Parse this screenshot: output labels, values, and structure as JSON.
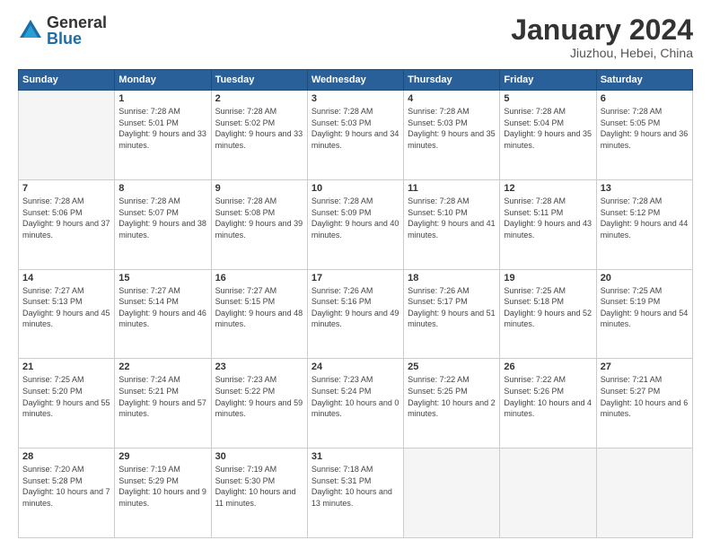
{
  "header": {
    "logo_general": "General",
    "logo_blue": "Blue",
    "month_title": "January 2024",
    "location": "Jiuzhou, Hebei, China"
  },
  "weekdays": [
    "Sunday",
    "Monday",
    "Tuesday",
    "Wednesday",
    "Thursday",
    "Friday",
    "Saturday"
  ],
  "weeks": [
    [
      {
        "day": "",
        "empty": true
      },
      {
        "day": "1",
        "sunrise": "7:28 AM",
        "sunset": "5:01 PM",
        "daylight": "9 hours and 33 minutes."
      },
      {
        "day": "2",
        "sunrise": "7:28 AM",
        "sunset": "5:02 PM",
        "daylight": "9 hours and 33 minutes."
      },
      {
        "day": "3",
        "sunrise": "7:28 AM",
        "sunset": "5:03 PM",
        "daylight": "9 hours and 34 minutes."
      },
      {
        "day": "4",
        "sunrise": "7:28 AM",
        "sunset": "5:03 PM",
        "daylight": "9 hours and 35 minutes."
      },
      {
        "day": "5",
        "sunrise": "7:28 AM",
        "sunset": "5:04 PM",
        "daylight": "9 hours and 35 minutes."
      },
      {
        "day": "6",
        "sunrise": "7:28 AM",
        "sunset": "5:05 PM",
        "daylight": "9 hours and 36 minutes."
      }
    ],
    [
      {
        "day": "7",
        "sunrise": "7:28 AM",
        "sunset": "5:06 PM",
        "daylight": "9 hours and 37 minutes."
      },
      {
        "day": "8",
        "sunrise": "7:28 AM",
        "sunset": "5:07 PM",
        "daylight": "9 hours and 38 minutes."
      },
      {
        "day": "9",
        "sunrise": "7:28 AM",
        "sunset": "5:08 PM",
        "daylight": "9 hours and 39 minutes."
      },
      {
        "day": "10",
        "sunrise": "7:28 AM",
        "sunset": "5:09 PM",
        "daylight": "9 hours and 40 minutes."
      },
      {
        "day": "11",
        "sunrise": "7:28 AM",
        "sunset": "5:10 PM",
        "daylight": "9 hours and 41 minutes."
      },
      {
        "day": "12",
        "sunrise": "7:28 AM",
        "sunset": "5:11 PM",
        "daylight": "9 hours and 43 minutes."
      },
      {
        "day": "13",
        "sunrise": "7:28 AM",
        "sunset": "5:12 PM",
        "daylight": "9 hours and 44 minutes."
      }
    ],
    [
      {
        "day": "14",
        "sunrise": "7:27 AM",
        "sunset": "5:13 PM",
        "daylight": "9 hours and 45 minutes."
      },
      {
        "day": "15",
        "sunrise": "7:27 AM",
        "sunset": "5:14 PM",
        "daylight": "9 hours and 46 minutes."
      },
      {
        "day": "16",
        "sunrise": "7:27 AM",
        "sunset": "5:15 PM",
        "daylight": "9 hours and 48 minutes."
      },
      {
        "day": "17",
        "sunrise": "7:26 AM",
        "sunset": "5:16 PM",
        "daylight": "9 hours and 49 minutes."
      },
      {
        "day": "18",
        "sunrise": "7:26 AM",
        "sunset": "5:17 PM",
        "daylight": "9 hours and 51 minutes."
      },
      {
        "day": "19",
        "sunrise": "7:25 AM",
        "sunset": "5:18 PM",
        "daylight": "9 hours and 52 minutes."
      },
      {
        "day": "20",
        "sunrise": "7:25 AM",
        "sunset": "5:19 PM",
        "daylight": "9 hours and 54 minutes."
      }
    ],
    [
      {
        "day": "21",
        "sunrise": "7:25 AM",
        "sunset": "5:20 PM",
        "daylight": "9 hours and 55 minutes."
      },
      {
        "day": "22",
        "sunrise": "7:24 AM",
        "sunset": "5:21 PM",
        "daylight": "9 hours and 57 minutes."
      },
      {
        "day": "23",
        "sunrise": "7:23 AM",
        "sunset": "5:22 PM",
        "daylight": "9 hours and 59 minutes."
      },
      {
        "day": "24",
        "sunrise": "7:23 AM",
        "sunset": "5:24 PM",
        "daylight": "10 hours and 0 minutes."
      },
      {
        "day": "25",
        "sunrise": "7:22 AM",
        "sunset": "5:25 PM",
        "daylight": "10 hours and 2 minutes."
      },
      {
        "day": "26",
        "sunrise": "7:22 AM",
        "sunset": "5:26 PM",
        "daylight": "10 hours and 4 minutes."
      },
      {
        "day": "27",
        "sunrise": "7:21 AM",
        "sunset": "5:27 PM",
        "daylight": "10 hours and 6 minutes."
      }
    ],
    [
      {
        "day": "28",
        "sunrise": "7:20 AM",
        "sunset": "5:28 PM",
        "daylight": "10 hours and 7 minutes."
      },
      {
        "day": "29",
        "sunrise": "7:19 AM",
        "sunset": "5:29 PM",
        "daylight": "10 hours and 9 minutes."
      },
      {
        "day": "30",
        "sunrise": "7:19 AM",
        "sunset": "5:30 PM",
        "daylight": "10 hours and 11 minutes."
      },
      {
        "day": "31",
        "sunrise": "7:18 AM",
        "sunset": "5:31 PM",
        "daylight": "10 hours and 13 minutes."
      },
      {
        "day": "",
        "empty": true
      },
      {
        "day": "",
        "empty": true
      },
      {
        "day": "",
        "empty": true
      }
    ]
  ]
}
